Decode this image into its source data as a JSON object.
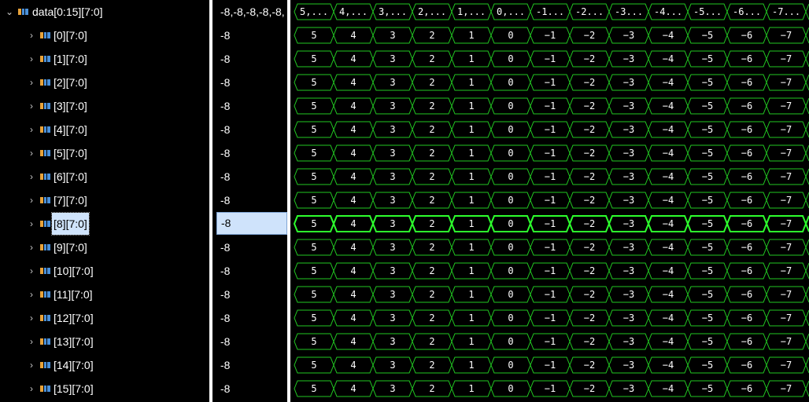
{
  "names": {
    "root": {
      "label": "data[0:15][7:0]",
      "chevron": "chevron-down-icon",
      "icon": "bus-icon"
    },
    "items": [
      {
        "label": "[0][7:0]"
      },
      {
        "label": "[1][7:0]"
      },
      {
        "label": "[2][7:0]"
      },
      {
        "label": "[3][7:0]"
      },
      {
        "label": "[4][7:0]"
      },
      {
        "label": "[5][7:0]"
      },
      {
        "label": "[6][7:0]"
      },
      {
        "label": "[7][7:0]"
      },
      {
        "label": "[8][7:0]",
        "selected": true
      },
      {
        "label": "[9][7:0]"
      },
      {
        "label": "[10][7:0]"
      },
      {
        "label": "[11][7:0]"
      },
      {
        "label": "[12][7:0]"
      },
      {
        "label": "[13][7:0]"
      },
      {
        "label": "[14][7:0]"
      },
      {
        "label": "[15][7:0]"
      }
    ]
  },
  "values": {
    "root": "-8,-8,-8,-8,-8,",
    "items": [
      "-8",
      "-8",
      "-8",
      "-8",
      "-8",
      "-8",
      "-8",
      "-8",
      "-8",
      "-8",
      "-8",
      "-8",
      "-8",
      "-8",
      "-8",
      "-8"
    ]
  },
  "waveform": {
    "root_labels": [
      "5,...",
      "4,...",
      "3,...",
      "2,...",
      "1,...",
      "0,...",
      "-1...",
      "-2...",
      "-3...",
      "-4...",
      "-5...",
      "-6...",
      "-7..."
    ],
    "row_values": [
      "5",
      "4",
      "3",
      "2",
      "1",
      "0",
      "−1",
      "−2",
      "−3",
      "−4",
      "−5",
      "−6",
      "−7"
    ],
    "selected_row": 8,
    "colors": {
      "wave": "#22c922",
      "wave_selected": "#2dff2d",
      "text": "#ffffff",
      "background": "#000000"
    }
  }
}
